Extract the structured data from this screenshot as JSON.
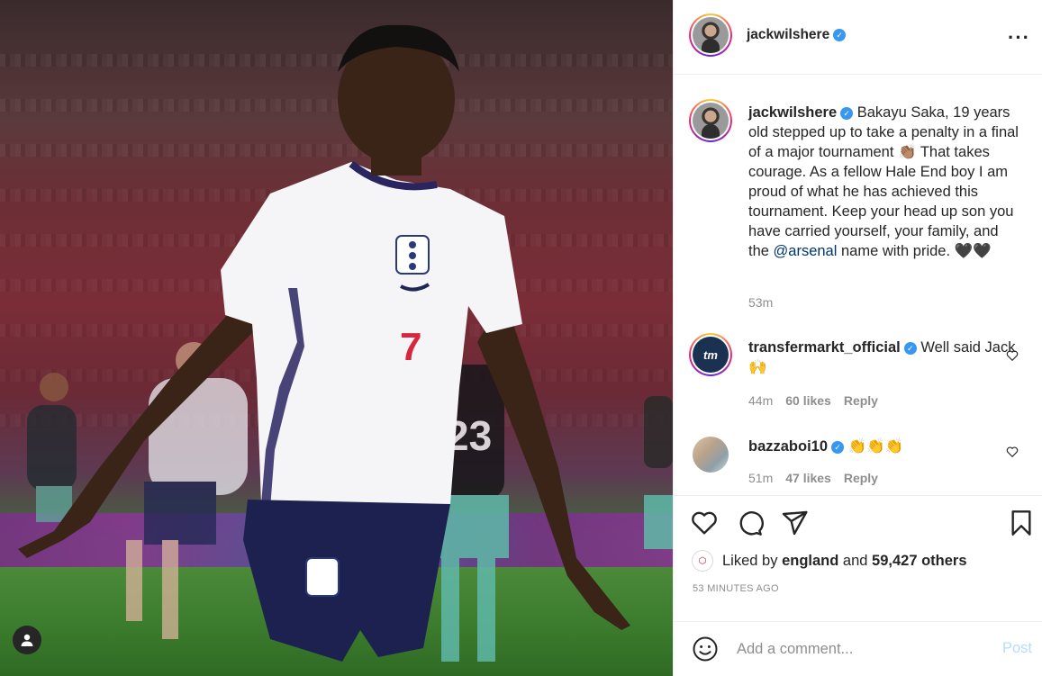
{
  "post": {
    "author": "jackwilshere",
    "verified": true
  },
  "caption": {
    "username": "jackwilshere",
    "text_before_mention": "Bakayu Saka, 19 years old stepped up to take a penalty in a final of a major tournament 👏🏽 That takes courage. As a fellow Hale End boy I am proud of what he has achieved this tournament. Keep your head up son you have carried yourself, your family, and the ",
    "mention": "@arsenal",
    "text_after_mention": " name with pride. 🖤🖤",
    "time": "53m"
  },
  "comments": [
    {
      "username": "transfermarkt_official",
      "avatar_text": "tm",
      "text": "Well said Jack🙌",
      "time": "44m",
      "likes": "60 likes",
      "reply": "Reply"
    },
    {
      "username": "bazzaboi10",
      "text": "👏👏👏",
      "time": "51m",
      "likes": "47 likes",
      "reply": "Reply"
    }
  ],
  "likes": {
    "prefix": "Liked by",
    "user": "england",
    "conj": "and",
    "others": "59,427 others"
  },
  "post_time": "53 MINUTES AGO",
  "add_comment": {
    "placeholder": "Add a comment...",
    "post_label": "Post"
  },
  "colors": {
    "verified": "#3897f0",
    "mention": "#00376b",
    "post_disabled": "#b2dffc"
  }
}
